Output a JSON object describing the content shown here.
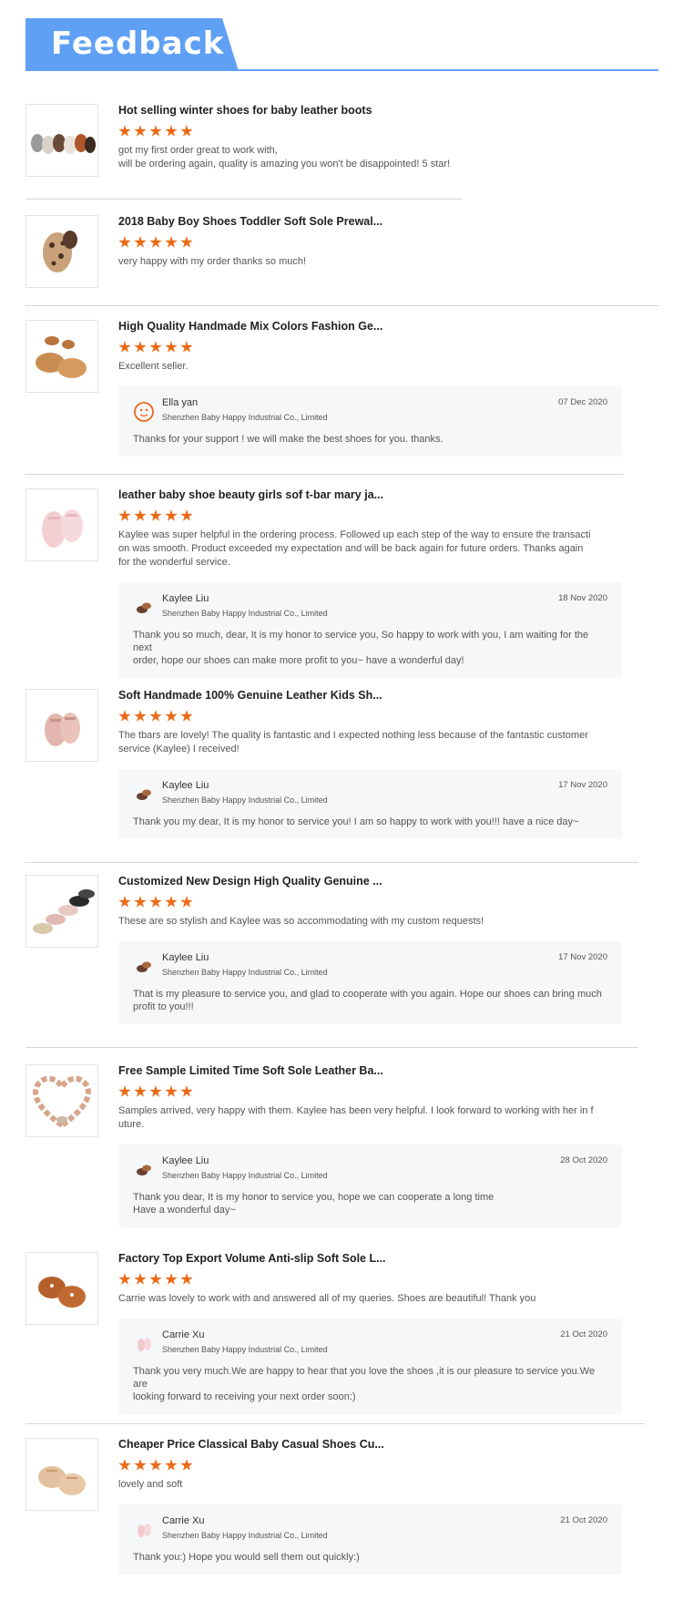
{
  "header": {
    "title": "Feedback",
    "accent_color": "#5fa0f5"
  },
  "star_color": "#ec6a16",
  "reviews": [
    {
      "title": "Hot selling winter shoes for baby leather boots",
      "rating": 5,
      "comment": "got my first order great to work with,\nwill be ordering again, quality is amazing you won't be disappointed! 5 star!",
      "thumb_icon": "baby-boots-row-icon",
      "reply": null
    },
    {
      "title": "2018 Baby Boy Shoes Toddler Soft Sole Prewal...",
      "rating": 5,
      "comment": "very happy with my order thanks so much!",
      "thumb_icon": "leopard-baby-shoe-icon",
      "reply": null
    },
    {
      "title": "High Quality Handmade Mix Colors Fashion Ge...",
      "rating": 5,
      "comment": "Excellent seller.",
      "thumb_icon": "tan-mary-jane-icon",
      "reply": {
        "name": "Ella yan",
        "company": "Shenzhen Baby Happy Industrial Co., Limited",
        "date": "07 Dec 2020",
        "text": "Thanks for your support ! we will make the best shoes for you. thanks.",
        "avatar_icon": "cartoon-face-avatar-icon"
      }
    },
    {
      "title": "leather baby shoe beauty girls sof t-bar mary ja...",
      "rating": 5,
      "comment": "Kaylee was super helpful in the ordering process.  Followed up each step of the way to ensure the transacti\non was smooth.  Product exceeded my expectation and will be back again for future orders.  Thanks again\nfor the wonderful service.",
      "thumb_icon": "pink-t-bar-shoe-icon",
      "reply": {
        "name": "Kaylee Liu",
        "company": "Shenzhen Baby Happy Industrial Co., Limited",
        "date": "18 Nov 2020",
        "text": "Thank you so much, dear, It is my honor to service you, So happy to work with you, I am waiting for the next\norder, hope our shoes can make more profit to you~ have a wonderful day!",
        "avatar_icon": "shoe-avatar-icon"
      }
    },
    {
      "title": "Soft Handmade 100% Genuine Leather Kids Sh...",
      "rating": 5,
      "comment": "The tbars are lovely! The quality is fantastic and I expected nothing less because of the fantastic customer\nservice (Kaylee) I received!",
      "thumb_icon": "blush-t-bar-shoe-icon",
      "reply": {
        "name": "Kaylee Liu",
        "company": "Shenzhen Baby Happy Industrial Co., Limited",
        "date": "17 Nov 2020",
        "text": "Thank you my dear,  It is my honor to service you! I am so happy to work with you!!! have a nice day~",
        "avatar_icon": "shoe-avatar-icon"
      }
    },
    {
      "title": "Customized New Design High Quality Genuine ...",
      "rating": 5,
      "comment": "These are so stylish and Kaylee was so accommodating with my custom requests!",
      "thumb_icon": "shoe-collection-icon",
      "reply": {
        "name": "Kaylee Liu",
        "company": "Shenzhen Baby Happy Industrial Co., Limited",
        "date": "17 Nov 2020",
        "text": "That is my pleasure to service you, and glad to cooperate with you again. Hope our shoes can bring much\nprofit to you!!!",
        "avatar_icon": "shoe-avatar-icon"
      }
    },
    {
      "title": "Free Sample Limited Time Soft Sole Leather Ba...",
      "rating": 5,
      "comment": "Samples arrived, very happy with them. Kaylee has been very helpful. I look forward to working with her in f\nuture.",
      "thumb_icon": "heart-of-shoes-icon",
      "reply": {
        "name": "Kaylee Liu",
        "company": "Shenzhen Baby Happy Industrial Co., Limited",
        "date": "28 Oct 2020",
        "text": "Thank you dear, It is my honor to service you, hope we can cooperate a long time\nHave a wonderful day~",
        "avatar_icon": "shoe-avatar-icon"
      }
    },
    {
      "title": "Factory Top Export Volume Anti-slip Soft Sole L...",
      "rating": 5,
      "comment": "Carrie was lovely to work with and answered all of my queries. Shoes are beautiful! Thank you",
      "thumb_icon": "brown-cutout-shoe-icon",
      "reply": {
        "name": "Carrie Xu",
        "company": "Shenzhen Baby Happy Industrial Co., Limited",
        "date": "21 Oct 2020",
        "text": "Thank you very much.We are happy to hear that you love the shoes ,it is our pleasure to service you.We are\nlooking forward to receiving your next order soon:)",
        "avatar_icon": "pink-shoe-avatar-icon"
      }
    },
    {
      "title": "Cheaper Price Classical Baby Casual Shoes Cu...",
      "rating": 5,
      "comment": "lovely and soft",
      "thumb_icon": "beige-oxford-shoe-icon",
      "reply": {
        "name": "Carrie Xu",
        "company": "Shenzhen Baby Happy Industrial Co., Limited",
        "date": "21 Oct 2020",
        "text": "Thank you:) Hope you would sell them out quickly:)",
        "avatar_icon": "pink-shoe-avatar-icon"
      }
    }
  ]
}
